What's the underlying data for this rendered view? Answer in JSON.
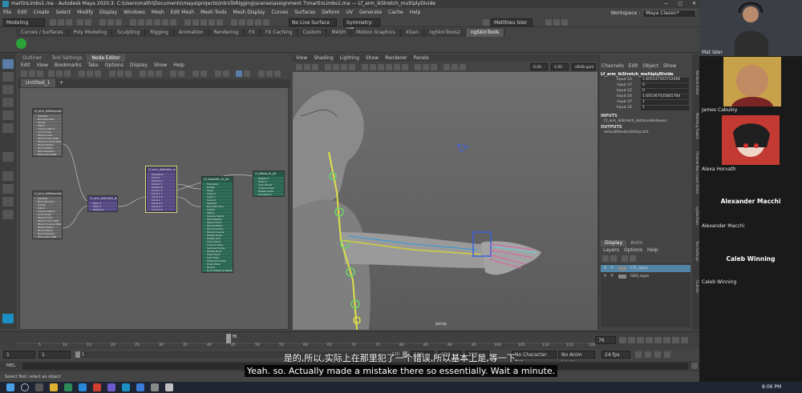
{
  "window": {
    "title": "martinLimbs1.ma - Autodesk Maya 2020.3: C:\\Users\\mathi\\Documents\\maya\\projects\\IntroToRigging\\scenes\\assignment 7\\martinLimbs1.ma   ---   Lf_arm_ikStretch_multiplyDivide",
    "controls": [
      "—",
      "▢",
      "✕"
    ]
  },
  "menubar": {
    "items": [
      "File",
      "Edit",
      "Create",
      "Select",
      "Modify",
      "Display",
      "Windows",
      "Mesh",
      "Edit Mesh",
      "Mesh Tools",
      "Mesh Display",
      "Curves",
      "Surfaces",
      "Deform",
      "UV",
      "Generate",
      "Cache",
      "Help"
    ],
    "workspace_label": "Workspace :",
    "workspace_value": "Maya Classic*"
  },
  "statusline": {
    "menuset": "Modeling",
    "live_surface": "No Live Surface",
    "symmetry": "Symmetry: Off",
    "user": "Matthieu Isler"
  },
  "shelf_tabs": [
    "Curves / Surfaces",
    "Poly Modeling",
    "Sculpting",
    "Rigging",
    "Animation",
    "Rendering",
    "FX",
    "FX Caching",
    "Custom",
    "MASH",
    "Motion Graphics",
    "XGen",
    "ngSkinTools2",
    "ngSkinTools"
  ],
  "node_editor": {
    "panel_tabs": [
      "Outliner",
      "Tool Settings",
      "Node Editor"
    ],
    "menu": [
      "Edit",
      "View",
      "Bookmarks",
      "Tabs",
      "Options",
      "Display",
      "Show",
      "Help"
    ],
    "tab_name": "Untitled_1",
    "tab_add": "+",
    "nodes": {
      "a1": {
        "title": "Lf_arm_ikElementJnt_posShape",
        "rows": [
          "Visibility",
          "Bounding Box",
          "Center",
          "Matrix",
          "Inverse Matrix",
          "Local Scale",
          "Object Color",
          "Object Color RGB",
          "Parent Inverse Matrix",
          "Parent Matrix",
          "World Matrix",
          "World Position",
          "Wire Color RGB"
        ]
      },
      "a2": {
        "title": "Lf_arm_ikElementJnt_posShape",
        "rows": [
          "Visibility",
          "Bounding Box",
          "Center",
          "Matrix",
          "Inverse Matrix",
          "Local Scale",
          "Object Color",
          "Object Color RGB",
          "Parent Inverse Matrix",
          "Parent Matrix",
          "World Matrix",
          "World Position",
          "Wire Color RGB"
        ]
      },
      "dist": {
        "title": "Lf_arm_ikStretch_distanceBetween",
        "rows": [
          "Point 1",
          "Point 2",
          "Distance"
        ]
      },
      "mult": {
        "title": "Lf_arm_ikStretch_multiplyDivide",
        "rows": [
          "Operation",
          "Input 1",
          "Output X",
          "Output Y",
          "Output Z",
          "Input 1 X",
          "Input 1 Y",
          "Input 1 Z",
          "Input 2",
          "Input 2 X",
          "Input 2 Y",
          "Input 2 Z"
        ]
      },
      "jnt": {
        "title": "Lf_shoulder_ik_jnt",
        "rows": [
          "Translate",
          "Rotate",
          "Scale",
          "Scale X",
          "Scale Y",
          "Scale Z",
          "Visibility",
          "Bounding Box",
          "Center",
          "Matrix",
          "Inverse Matrix",
          "World Matrix",
          "Object Color",
          "Parent Matrix",
          "World Position",
          "Parent Inverse",
          "Rotate Order",
          "Rotate Axis",
          "Joint Orient",
          "Inverse Scale",
          "Segment Scale",
          "Rotate Pivot",
          "Scale Pivot",
          "Joint Type",
          "Preferred Angle",
          "Draw Style",
          "Radius",
          "Lock Influence Weights"
        ]
      },
      "elbow": {
        "title": "Lf_elbow_ik_jnt",
        "rows": [
          "Rotate X",
          "Scale X",
          "Joint Orient",
          "Inverse Scale",
          "Rotate Order",
          "Translate X"
        ]
      }
    }
  },
  "viewport": {
    "menu": [
      "View",
      "Shading",
      "Lighting",
      "Show",
      "Renderer",
      "Panels"
    ],
    "field_a": "0.00",
    "field_b": "1.00",
    "color_space": "sRGB gam",
    "camera_label": "persp"
  },
  "channel_box": {
    "menu": [
      "Channels",
      "Edit",
      "Object",
      "Show"
    ],
    "node_name": "Lf_arm_ikStretch_multiplyDivide",
    "attrs": [
      {
        "name": "Input 1X",
        "value": "1.605337352752666"
      },
      {
        "name": "Input 1Y",
        "value": "0"
      },
      {
        "name": "Input 1Z",
        "value": "0"
      },
      {
        "name": "Input 2X",
        "value": "1.605367035865784"
      },
      {
        "name": "Input 2Y",
        "value": "1"
      },
      {
        "name": "Input 2Z",
        "value": "1"
      }
    ],
    "inputs_label": "INPUTS",
    "inputs_item": "Lf_arm_ikStretch_distanceBetween",
    "outputs_label": "OUTPUTS",
    "outputs_item": "defaultRenderUtilityList1"
  },
  "layer_editor": {
    "tabs": [
      "Display",
      "Anim"
    ],
    "menu": [
      "Layers",
      "Options",
      "Help"
    ],
    "layers": [
      {
        "v": "V",
        "p": "P",
        "name": "CTL_layer",
        "selected": true
      },
      {
        "v": "V",
        "p": "P",
        "name": "GEO_layer",
        "selected": false
      }
    ]
  },
  "side_tabs": [
    "Attribute Editor",
    "Modeling Toolkit",
    "Channel Box / Layer Editor",
    "ngSkinTools",
    "Tool Settings",
    "Outliner"
  ],
  "time_slider": {
    "ticks": [
      "5",
      "10",
      "15",
      "20",
      "25",
      "30",
      "35",
      "40",
      "45",
      "50",
      "55",
      "60",
      "65",
      "70",
      "75",
      "80",
      "85",
      "90",
      "95",
      "100",
      "105",
      "110",
      "115",
      "120"
    ],
    "current_frame": "76",
    "current_field": "76"
  },
  "range_slider": {
    "start": "1",
    "start_inner": "1",
    "range_start_label": "1",
    "end_inner": "120",
    "end_mid": "120",
    "end_outer": "200",
    "end_field": "200",
    "character_set": "No Character Set",
    "anim_layer": "No Anim Layer",
    "fps": "24 fps"
  },
  "command_line": {
    "label": "MEL"
  },
  "help_line": "Select Tool: select an object",
  "subtitles": {
    "zh": "是的,所以,实际上在那里犯了一个错误,所以基本上是,等一下.",
    "en": "Yeah. so. Actually made a mistake there so essentially. Wait a minute."
  },
  "participants": [
    {
      "name": "Mat Isler"
    },
    {
      "name": "James Cabuloy"
    },
    {
      "name": "Alexa Horvath"
    },
    {
      "name": "Alexander Macchi",
      "big": "Alexander Macchi"
    },
    {
      "name": "Caleb Winning",
      "big": "Caleb Winning"
    }
  ],
  "taskbar": {
    "time": "8:06 PM"
  },
  "colors": {
    "maya_bg": "#444444",
    "node_purple": "#5b4f89",
    "node_green": "#2f6d58",
    "layer_selected": "#5285a6",
    "subtitle_bg": "#000000"
  }
}
